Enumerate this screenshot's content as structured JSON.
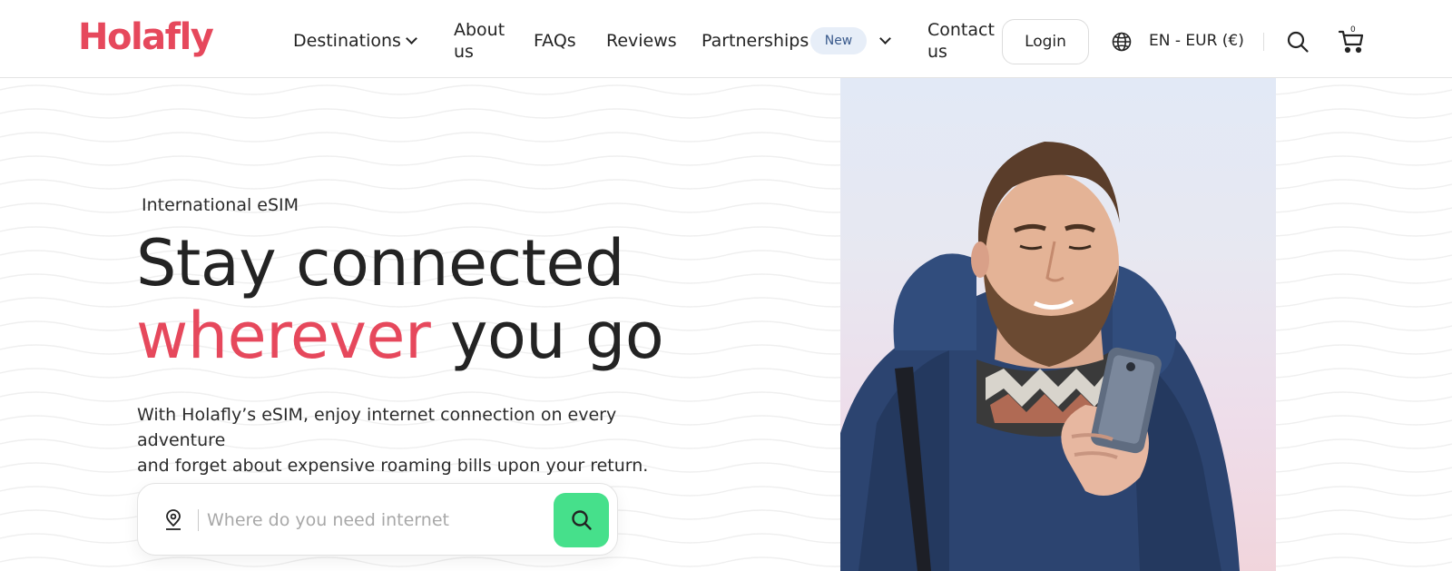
{
  "header": {
    "logo": "Holafly",
    "nav": {
      "destinations": "Destinations",
      "about_line1": "About",
      "about_line2": "us",
      "faqs": "FAQs",
      "reviews": "Reviews",
      "partnerships": "Partnerships",
      "partnerships_badge": "New",
      "contact_line1": "Contact",
      "contact_line2": "us"
    },
    "login_label": "Login",
    "language": "EN - EUR (€)",
    "cart_count": "0",
    "icons": [
      "chevron-down-icon",
      "globe-icon",
      "search-icon",
      "cart-icon"
    ]
  },
  "hero": {
    "eyebrow": "International eSIM",
    "headline_line1": "Stay connected",
    "headline_accent": "wherever",
    "headline_rest": "you go",
    "subcopy_line1": "With Holafly’s eSIM, enjoy internet connection on every adventure",
    "subcopy_line2": "and forget about expensive roaming bills upon your return.",
    "search": {
      "placeholder": "Where do you need internet",
      "value": ""
    },
    "icons": [
      "location-pin-icon",
      "search-icon"
    ]
  },
  "colors": {
    "brand": "#e6485c",
    "search_button": "#46e08b",
    "badge_bg": "#e7eef8",
    "text": "#232323"
  }
}
